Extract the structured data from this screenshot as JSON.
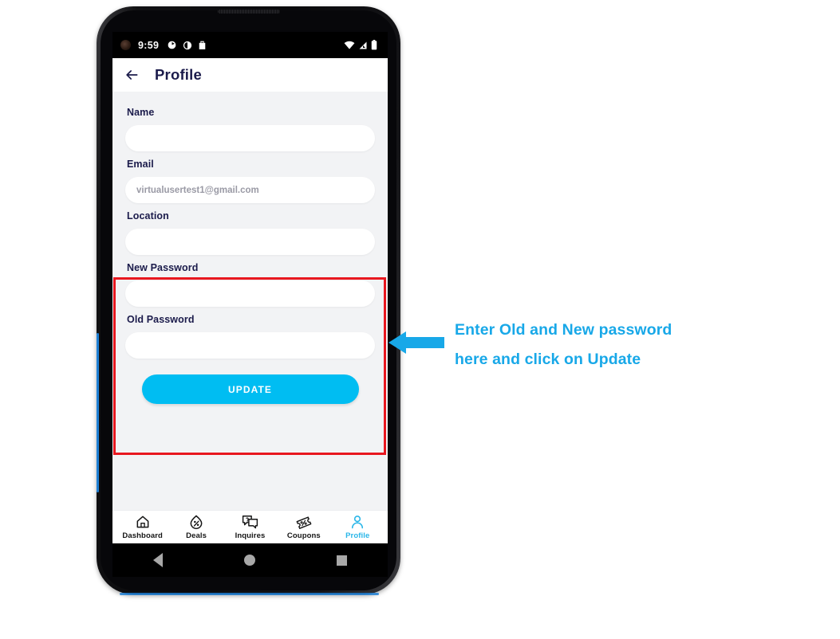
{
  "statusbar": {
    "time": "9:59",
    "left_icons": [
      "notification-circle-icon",
      "notification-half-circle-icon",
      "notification-bag-icon"
    ],
    "right_icons": [
      "wifi-icon",
      "cell-signal-icon",
      "battery-icon"
    ]
  },
  "appbar": {
    "back_icon": "back-arrow-icon",
    "title": "Profile"
  },
  "form": {
    "fields": [
      {
        "label": "Name",
        "value": "",
        "placeholder": "",
        "name": "name"
      },
      {
        "label": "Email",
        "value": "",
        "placeholder": "virtualusertest1@gmail.com",
        "name": "email"
      },
      {
        "label": "Location",
        "value": "",
        "placeholder": "",
        "name": "location"
      },
      {
        "label": "New Password",
        "value": "",
        "placeholder": "",
        "name": "new-password"
      },
      {
        "label": "Old Password",
        "value": "",
        "placeholder": "",
        "name": "old-password"
      }
    ],
    "update_label": "UPDATE"
  },
  "bottom_nav": {
    "items": [
      {
        "label": "Dashboard",
        "icon": "home-icon",
        "active": false
      },
      {
        "label": "Deals",
        "icon": "percent-droplet-icon",
        "active": false
      },
      {
        "label": "Inquires",
        "icon": "chat-question-icon",
        "active": false
      },
      {
        "label": "Coupons",
        "icon": "ticket-percent-icon",
        "active": false
      },
      {
        "label": "Profile",
        "icon": "person-icon",
        "active": true
      }
    ]
  },
  "android_nav": {
    "back": "android-back-icon",
    "home": "android-home-icon",
    "recents": "android-recents-icon"
  },
  "annotation": {
    "line1": "Enter Old and New password",
    "line2": "here and click on Update",
    "arrow": "left-arrow-callout",
    "highlight": "red-highlight-box"
  },
  "colors": {
    "accent_cyan": "#00bdf2",
    "annotation_cyan": "#18a8e8",
    "highlight_red": "#e8171f",
    "label_navy": "#1b1b4b",
    "screen_bg": "#f2f3f5"
  }
}
